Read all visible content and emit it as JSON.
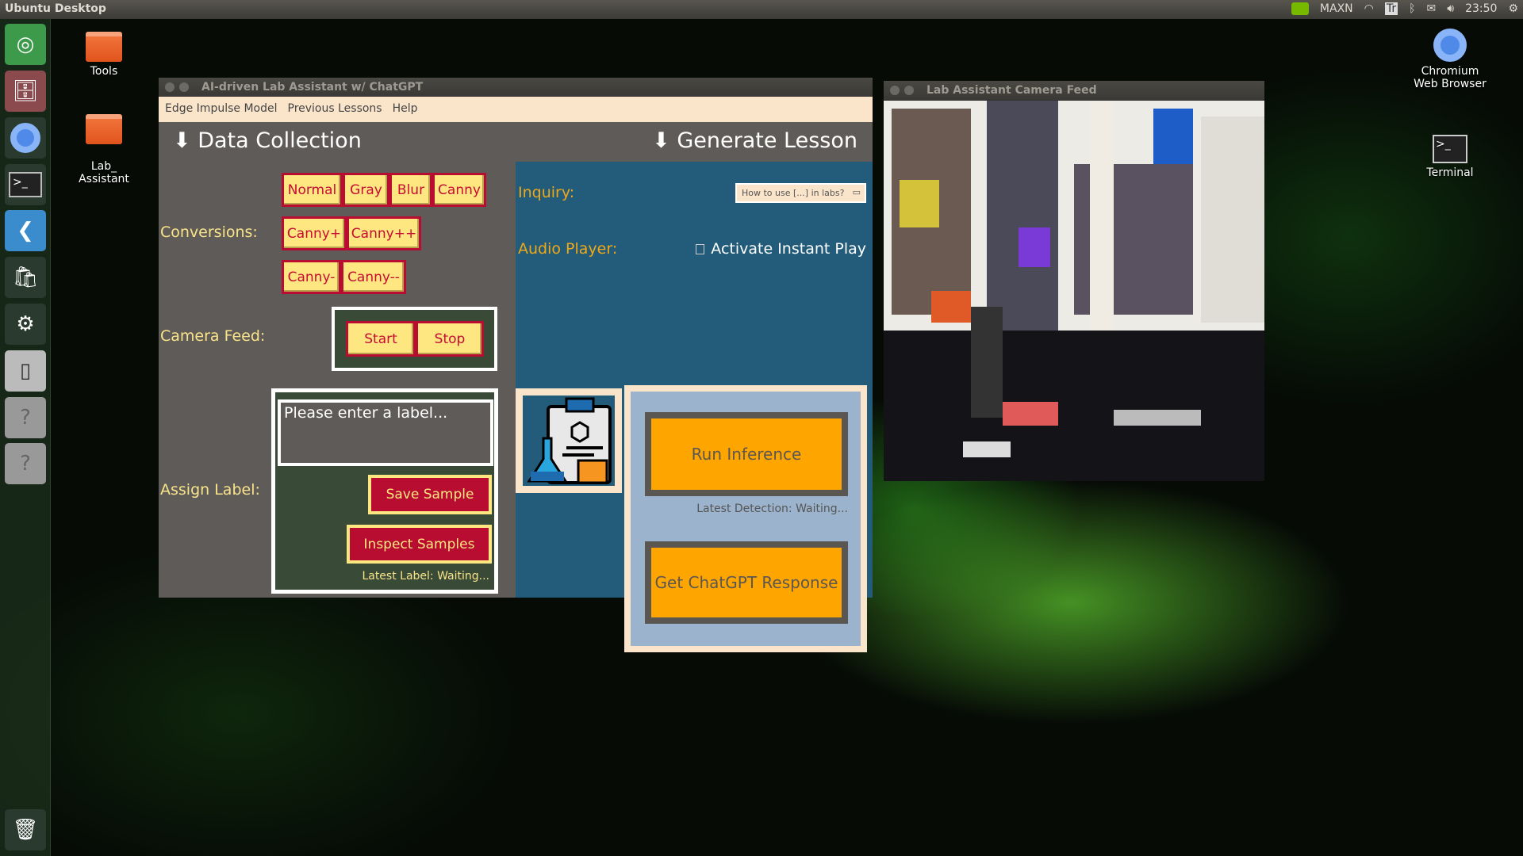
{
  "topbar": {
    "title": "Ubuntu Desktop",
    "mode": "MAXN",
    "keyboard": "Tr",
    "time": "23:50"
  },
  "launcher": [
    "ubuntu-dash",
    "files",
    "chromium",
    "terminal",
    "vscode",
    "software-center",
    "system-settings",
    "libreoffice",
    "unknown-app",
    "unknown-app",
    "trash"
  ],
  "desktop": {
    "tools": "Tools",
    "lab": "Lab_\nAssistant",
    "chromium": "Chromium Web Browser",
    "terminal": "Terminal"
  },
  "app": {
    "title": "AI-driven Lab Assistant w/ ChatGPT",
    "menu": [
      "Edge Impulse Model",
      "Previous Lessons",
      "Help"
    ],
    "data_collection": "⬇ Data Collection",
    "generate_lesson": "⬇ Generate Lesson",
    "conversions_label": "Conversions:",
    "conversions": [
      "Normal",
      "Gray",
      "Blur",
      "Canny",
      "Canny+",
      "Canny++",
      "Canny-",
      "Canny--"
    ],
    "camera_label": "Camera Feed:",
    "start": "Start",
    "stop": "Stop",
    "assign_label": "Assign Label:",
    "label_placeholder": "Please enter a label...",
    "save_sample": "Save Sample",
    "inspect_samples": "Inspect Samples",
    "latest_label": "Latest Label: Waiting...",
    "inquiry_label": "Inquiry:",
    "inquiry_value": "How to use [...] in labs?",
    "audio_label": "Audio Player:",
    "instant_play": "Activate Instant Play",
    "instant_play_checked": false,
    "run_inference": "Run Inference",
    "latest_detection": "Latest Detection: Waiting...",
    "chatgpt": "Get ChatGPT Response",
    "colors": {
      "button_yellow": "#fee680",
      "button_red": "#b80c30",
      "panel_blue": "#225c7a",
      "action_orange": "#fea500"
    }
  },
  "camera_window": {
    "title": "Lab Assistant Camera Feed"
  }
}
